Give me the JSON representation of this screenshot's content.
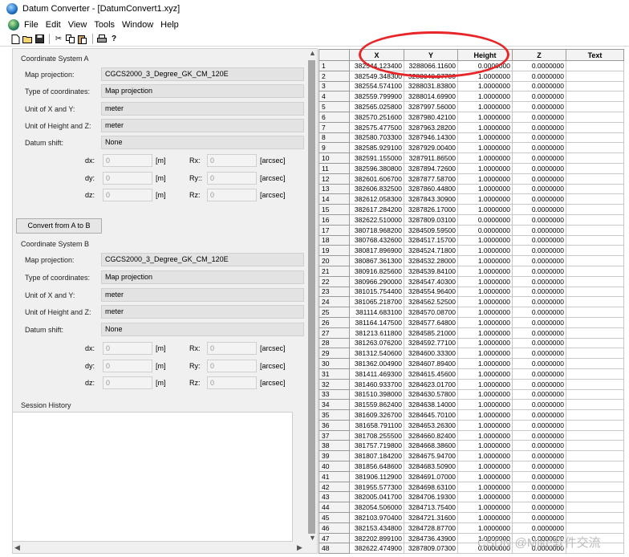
{
  "window": {
    "title": "Datum Converter - [DatumConvert1.xyz]"
  },
  "menu": [
    "File",
    "Edit",
    "View",
    "Tools",
    "Window",
    "Help"
  ],
  "toolbar": {
    "icons": [
      "new-icon",
      "open-icon",
      "save-icon",
      "cut-icon",
      "copy-icon",
      "paste-icon",
      "print-icon",
      "help-icon"
    ]
  },
  "system_a": {
    "heading": "Coordinate System A",
    "map_projection_label": "Map projection:",
    "map_projection": "CGCS2000_3_Degree_GK_CM_120E",
    "type_label": "Type of coordinates:",
    "type": "Map projection",
    "unit_xy_label": "Unit of X and Y:",
    "unit_xy": "meter",
    "unit_hz_label": "Unit of Height and Z:",
    "unit_hz": "meter",
    "datum_shift_label": "Datum shift:",
    "datum_shift": "None",
    "dx_label": "dx:",
    "dx": "0",
    "dy_label": "dy:",
    "dy": "0",
    "dz_label": "dz:",
    "dz": "0",
    "rx_label": "Rx:",
    "rx": "0",
    "ry_label": "Ry::",
    "ry": "0",
    "rz_label": "Rz:",
    "rz": "0",
    "unit_m": "[m]",
    "unit_arcsec": "[arcsec]"
  },
  "convert_button": "Convert from A to B",
  "system_b": {
    "heading": "Coordinate System B",
    "map_projection_label": "Map projection:",
    "map_projection": "CGCS2000_3_Degree_GK_CM_120E",
    "type_label": "Type of coordinates:",
    "type": "Map projection",
    "unit_xy_label": "Unit of X and Y:",
    "unit_xy": "meter",
    "unit_hz_label": "Unit of Height and Z:",
    "unit_hz": "meter",
    "datum_shift_label": "Datum shift:",
    "datum_shift": "None",
    "dx_label": "dx:",
    "dx": "0",
    "dy_label": "dy:",
    "dy": "0",
    "dz_label": "dz:",
    "dz": "0",
    "rx_label": "Rx:",
    "rx": "0",
    "ry_label": "Ry:",
    "ry": "0",
    "rz_label": "Rz:",
    "rz": "0",
    "unit_m": "[m]",
    "unit_arcsec": "[arcsec]"
  },
  "session_history": {
    "heading": "Session History"
  },
  "table": {
    "columns": [
      "X",
      "Y",
      "Height",
      "Z",
      "Text"
    ],
    "rows": [
      [
        "1",
        "382544.123400",
        "3288066.11600",
        "0.0000000",
        "0.0000000",
        ""
      ],
      [
        "2",
        "382549.348300",
        "3288048.97700",
        "1.0000000",
        "0.0000000",
        ""
      ],
      [
        "3",
        "382554.574100",
        "3288031.83800",
        "1.0000000",
        "0.0000000",
        ""
      ],
      [
        "4",
        "382559.799900",
        "3288014.69900",
        "1.0000000",
        "0.0000000",
        ""
      ],
      [
        "5",
        "382565.025800",
        "3287997.56000",
        "1.0000000",
        "0.0000000",
        ""
      ],
      [
        "6",
        "382570.251600",
        "3287980.42100",
        "1.0000000",
        "0.0000000",
        ""
      ],
      [
        "7",
        "382575.477500",
        "3287963.28200",
        "1.0000000",
        "0.0000000",
        ""
      ],
      [
        "8",
        "382580.703300",
        "3287946.14300",
        "1.0000000",
        "0.0000000",
        ""
      ],
      [
        "9",
        "382585.929100",
        "3287929.00400",
        "1.0000000",
        "0.0000000",
        ""
      ],
      [
        "10",
        "382591.155000",
        "3287911.86500",
        "1.0000000",
        "0.0000000",
        ""
      ],
      [
        "11",
        "382596.380800",
        "3287894.72600",
        "1.0000000",
        "0.0000000",
        ""
      ],
      [
        "12",
        "382601.606700",
        "3287877.58700",
        "1.0000000",
        "0.0000000",
        ""
      ],
      [
        "13",
        "382606.832500",
        "3287860.44800",
        "1.0000000",
        "0.0000000",
        ""
      ],
      [
        "14",
        "382612.058300",
        "3287843.30900",
        "1.0000000",
        "0.0000000",
        ""
      ],
      [
        "15",
        "382617.284200",
        "3287826.17000",
        "1.0000000",
        "0.0000000",
        ""
      ],
      [
        "16",
        "382622.510000",
        "3287809.03100",
        "0.0000000",
        "0.0000000",
        ""
      ],
      [
        "17",
        "380718.968200",
        "3284509.59500",
        "0.0000000",
        "0.0000000",
        ""
      ],
      [
        "18",
        "380768.432600",
        "3284517.15700",
        "1.0000000",
        "0.0000000",
        ""
      ],
      [
        "19",
        "380817.896900",
        "3284524.71800",
        "1.0000000",
        "0.0000000",
        ""
      ],
      [
        "20",
        "380867.361300",
        "3284532.28000",
        "1.0000000",
        "0.0000000",
        ""
      ],
      [
        "21",
        "380916.825600",
        "3284539.84100",
        "1.0000000",
        "0.0000000",
        ""
      ],
      [
        "22",
        "380966.290000",
        "3284547.40300",
        "1.0000000",
        "0.0000000",
        ""
      ],
      [
        "23",
        "381015.754400",
        "3284554.96400",
        "1.0000000",
        "0.0000000",
        ""
      ],
      [
        "24",
        "381065.218700",
        "3284562.52500",
        "1.0000000",
        "0.0000000",
        ""
      ],
      [
        "25",
        "381114.683100",
        "3284570.08700",
        "1.0000000",
        "0.0000000",
        ""
      ],
      [
        "26",
        "381164.147500",
        "3284577.64800",
        "1.0000000",
        "0.0000000",
        ""
      ],
      [
        "27",
        "381213.611800",
        "3284585.21000",
        "1.0000000",
        "0.0000000",
        ""
      ],
      [
        "28",
        "381263.076200",
        "3284592.77100",
        "1.0000000",
        "0.0000000",
        ""
      ],
      [
        "29",
        "381312.540600",
        "3284600.33300",
        "1.0000000",
        "0.0000000",
        ""
      ],
      [
        "30",
        "381362.004900",
        "3284607.89400",
        "1.0000000",
        "0.0000000",
        ""
      ],
      [
        "31",
        "381411.469300",
        "3284615.45600",
        "1.0000000",
        "0.0000000",
        ""
      ],
      [
        "32",
        "381460.933700",
        "3284623.01700",
        "1.0000000",
        "0.0000000",
        ""
      ],
      [
        "33",
        "381510.398000",
        "3284630.57800",
        "1.0000000",
        "0.0000000",
        ""
      ],
      [
        "34",
        "381559.862400",
        "3284638.14000",
        "1.0000000",
        "0.0000000",
        ""
      ],
      [
        "35",
        "381609.326700",
        "3284645.70100",
        "1.0000000",
        "0.0000000",
        ""
      ],
      [
        "36",
        "381658.791100",
        "3284653.26300",
        "1.0000000",
        "0.0000000",
        ""
      ],
      [
        "37",
        "381708.255500",
        "3284660.82400",
        "1.0000000",
        "0.0000000",
        ""
      ],
      [
        "38",
        "381757.719800",
        "3284668.38600",
        "1.0000000",
        "0.0000000",
        ""
      ],
      [
        "39",
        "381807.184200",
        "3284675.94700",
        "1.0000000",
        "0.0000000",
        ""
      ],
      [
        "40",
        "381856.648600",
        "3284683.50900",
        "1.0000000",
        "0.0000000",
        ""
      ],
      [
        "41",
        "381906.112900",
        "3284691.07000",
        "1.0000000",
        "0.0000000",
        ""
      ],
      [
        "42",
        "381955.577300",
        "3284698.63100",
        "1.0000000",
        "0.0000000",
        ""
      ],
      [
        "43",
        "382005.041700",
        "3284706.19300",
        "1.0000000",
        "0.0000000",
        ""
      ],
      [
        "44",
        "382054.506000",
        "3284713.75400",
        "1.0000000",
        "0.0000000",
        ""
      ],
      [
        "45",
        "382103.970400",
        "3284721.31600",
        "1.0000000",
        "0.0000000",
        ""
      ],
      [
        "46",
        "382153.434800",
        "3284728.87700",
        "1.0000000",
        "0.0000000",
        ""
      ],
      [
        "47",
        "382202.899100",
        "3284736.43900",
        "1.0000000",
        "0.0000000",
        ""
      ],
      [
        "48",
        "382622.474900",
        "3287809.07300",
        "0.0000000",
        "0.0000000",
        ""
      ]
    ]
  },
  "annotation_color": "#e8262a",
  "watermark": "CSDN @Mike软件交流"
}
